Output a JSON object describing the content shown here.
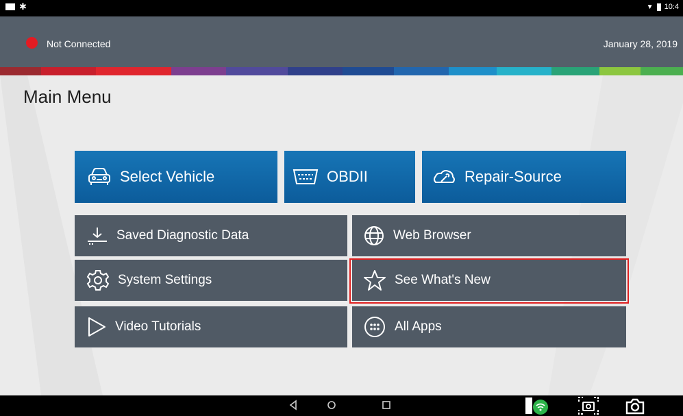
{
  "status_bar": {
    "time": "10:4"
  },
  "header": {
    "connection_status": "Not Connected",
    "date": "January 28, 2019",
    "colors": {
      "disconnected": "#e31b23"
    }
  },
  "stripe_colors": [
    "#9b2a30",
    "#c81f2c",
    "#e0262e",
    "#7d3e8f",
    "#514a9c",
    "#30408a",
    "#1f4b93",
    "#2266ae",
    "#1e8fc9",
    "#26b1c9",
    "#2aa377",
    "#8cc63f",
    "#4caf50"
  ],
  "main": {
    "title": "Main Menu",
    "primary_tiles": [
      {
        "label": "Select Vehicle",
        "icon": "car-icon"
      },
      {
        "label": "OBDII",
        "icon": "obd-connector-icon"
      },
      {
        "label": "Repair-Source",
        "icon": "wrench-icon"
      }
    ],
    "secondary_tiles": [
      {
        "label": "Saved Diagnostic Data",
        "icon": "download-icon"
      },
      {
        "label": "Web Browser",
        "icon": "globe-icon"
      },
      {
        "label": "System Settings",
        "icon": "gear-icon"
      },
      {
        "label": "See What's New",
        "icon": "star-icon",
        "highlighted": true
      },
      {
        "label": "Video Tutorials",
        "icon": "play-icon"
      },
      {
        "label": "All Apps",
        "icon": "apps-grid-icon"
      }
    ]
  },
  "nav_bar": {
    "buttons": [
      "back",
      "home",
      "recents",
      "wifi-connect",
      "screen-capture",
      "camera"
    ]
  }
}
